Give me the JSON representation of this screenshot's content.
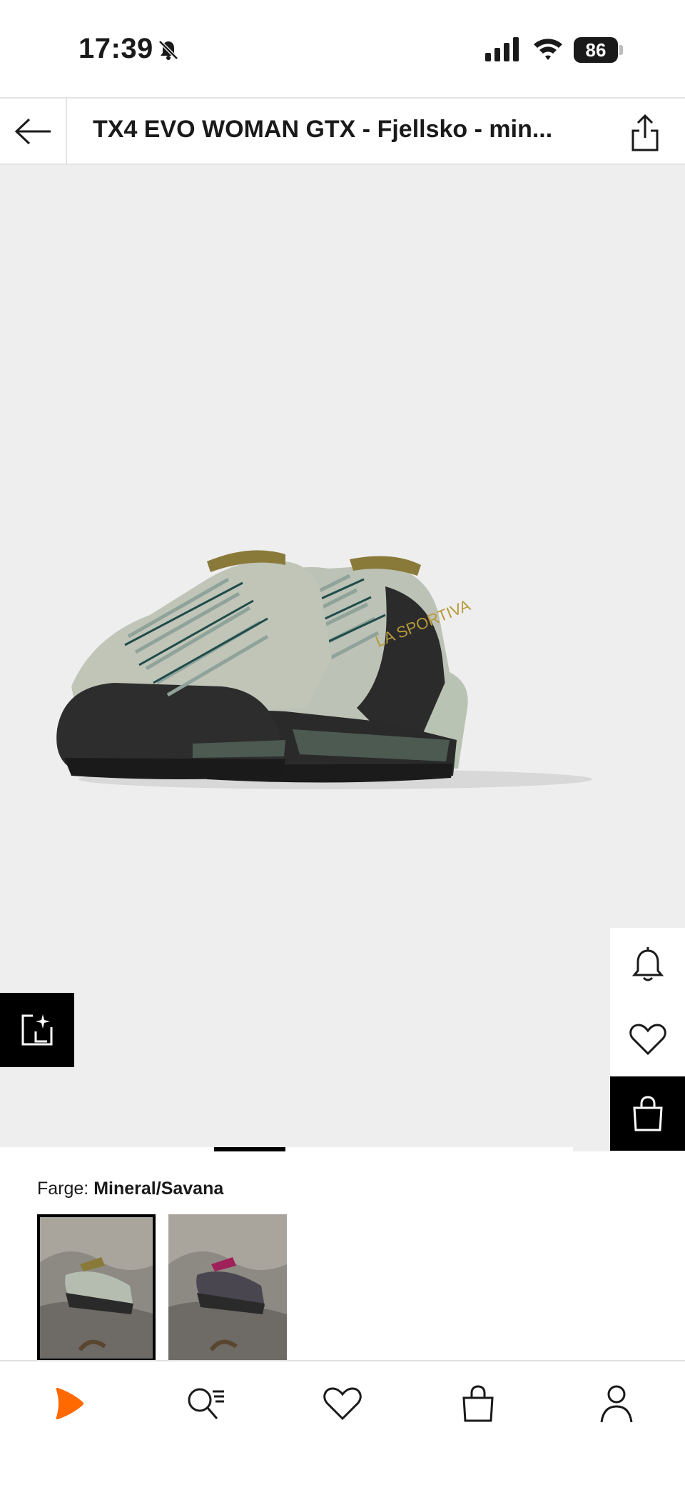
{
  "status_bar": {
    "time": "17:39",
    "battery": "86",
    "icons": [
      "bell-off-icon",
      "signal-icon",
      "wifi-icon",
      "battery-icon"
    ]
  },
  "header": {
    "title": "TX4 EVO WOMAN GTX - Fjellsko - min...",
    "back_icon": "arrow-left-icon",
    "share_icon": "share-icon"
  },
  "product": {
    "brand_on_shoe": "LA SPORTIVA",
    "image_count_indicator": 1
  },
  "actions": {
    "notify_icon": "bell-icon",
    "wishlist_icon": "heart-icon",
    "bag_icon": "shopping-bag-icon",
    "ai_icon": "sparkle-share-icon"
  },
  "color": {
    "label": "Farge:",
    "value": "Mineral/Savana",
    "swatches": [
      {
        "name": "Mineral/Savana",
        "selected": true
      },
      {
        "name": "alternate-colorway",
        "selected": false
      }
    ]
  },
  "bottom_nav": {
    "items": [
      {
        "icon": "home-logo-icon"
      },
      {
        "icon": "search-icon"
      },
      {
        "icon": "heart-icon"
      },
      {
        "icon": "bag-icon"
      },
      {
        "icon": "profile-icon"
      }
    ]
  },
  "colors": {
    "accent": "#ff6900",
    "black": "#000000",
    "hero_bg": "#eeeeee"
  }
}
